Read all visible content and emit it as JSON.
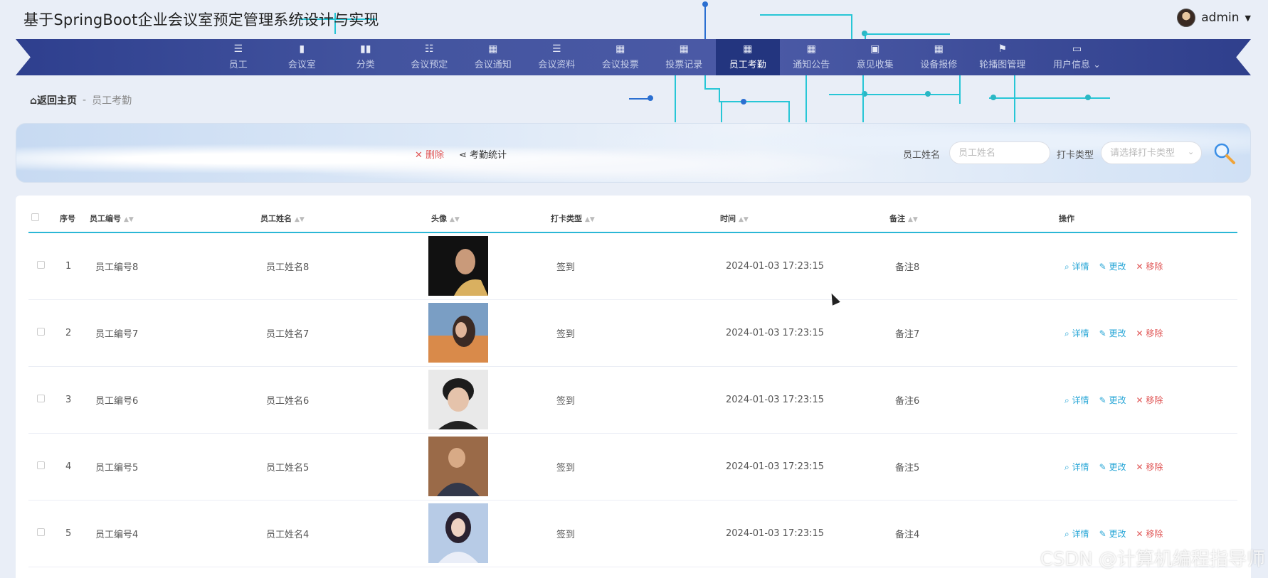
{
  "app": {
    "title": "基于SpringBoot企业会议室预定管理系统设计与实现"
  },
  "user": {
    "name": "admin"
  },
  "nav": {
    "items": [
      {
        "label": "员工",
        "icon": "list-icon"
      },
      {
        "label": "会议室",
        "icon": "tablet-icon"
      },
      {
        "label": "分类",
        "icon": "bar-chart-icon"
      },
      {
        "label": "会议预定",
        "icon": "sliders-icon"
      },
      {
        "label": "会议通知",
        "icon": "grid-icon"
      },
      {
        "label": "会议资料",
        "icon": "list-icon"
      },
      {
        "label": "会议投票",
        "icon": "grid-icon"
      },
      {
        "label": "投票记录",
        "icon": "grid-icon"
      },
      {
        "label": "员工考勤",
        "icon": "grid-icon",
        "active": true
      },
      {
        "label": "通知公告",
        "icon": "grid-icon"
      },
      {
        "label": "意见收集",
        "icon": "briefcase-icon"
      },
      {
        "label": "设备报修",
        "icon": "grid-icon"
      },
      {
        "label": "轮播图管理",
        "icon": "flag-icon"
      },
      {
        "label": "用户信息",
        "icon": "card-icon"
      }
    ]
  },
  "breadcrumb": {
    "home": "返回主页",
    "sep": "-",
    "current": "员工考勤"
  },
  "toolbar": {
    "delete_label": "删除",
    "stats_label": "考勤统计",
    "name_label": "员工姓名",
    "name_placeholder": "员工姓名",
    "type_label": "打卡类型",
    "type_placeholder": "请选择打卡类型"
  },
  "table": {
    "headers": [
      "序号",
      "员工编号",
      "员工姓名",
      "头像",
      "打卡类型",
      "时间",
      "备注",
      "操作"
    ],
    "actions": {
      "detail": "详情",
      "edit": "更改",
      "remove": "移除"
    },
    "rows": [
      {
        "no": "1",
        "emp_no": "员工编号8",
        "emp_name": "员工姓名8",
        "type": "签到",
        "time": "2024-01-03 17:23:15",
        "note": "备注8"
      },
      {
        "no": "2",
        "emp_no": "员工编号7",
        "emp_name": "员工姓名7",
        "type": "签到",
        "time": "2024-01-03 17:23:15",
        "note": "备注7"
      },
      {
        "no": "3",
        "emp_no": "员工编号6",
        "emp_name": "员工姓名6",
        "type": "签到",
        "time": "2024-01-03 17:23:15",
        "note": "备注6"
      },
      {
        "no": "4",
        "emp_no": "员工编号5",
        "emp_name": "员工姓名5",
        "type": "签到",
        "time": "2024-01-03 17:23:15",
        "note": "备注5"
      },
      {
        "no": "5",
        "emp_no": "员工编号4",
        "emp_name": "员工姓名4",
        "type": "签到",
        "time": "2024-01-03 17:23:15",
        "note": "备注4"
      }
    ]
  },
  "watermark": "CSDN @计算机编程指导师"
}
